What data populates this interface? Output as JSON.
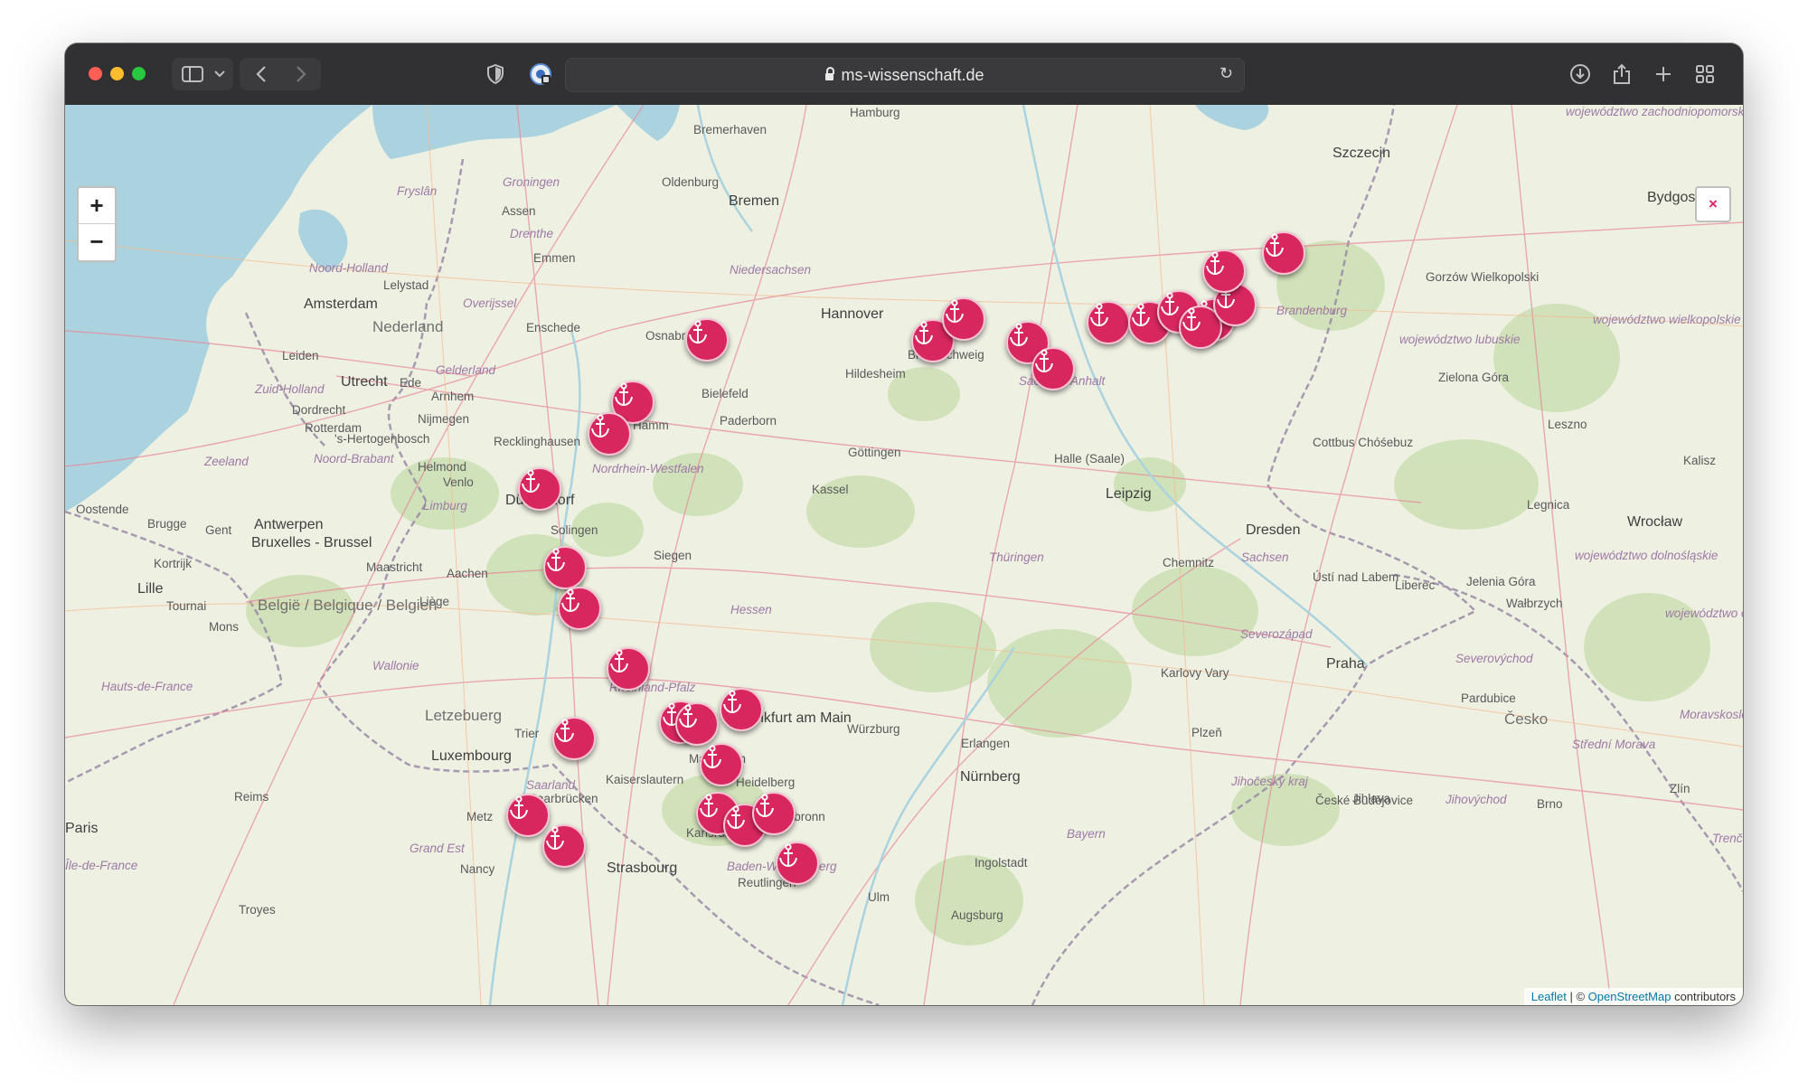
{
  "browser": {
    "url": "ms-wissenschaft.de"
  },
  "map": {
    "zoom_in_label": "+",
    "zoom_out_label": "−",
    "close_label": "×",
    "attribution": {
      "leaflet": "Leaflet",
      "separator": "| ©",
      "osm": "OpenStreetMap",
      "suffix": "contributors"
    },
    "marker_color": "#d8275f",
    "marker_icon": "anchor-icon",
    "marker_count": 36,
    "places": [
      "Hamburg",
      "Bremerhaven",
      "Szczecin",
      "Oldenburg",
      "Bremen",
      "Groningen",
      "Assen",
      "Fryslân",
      "Drenthe",
      "Emmen",
      "Niedersachsen",
      "Noord-Holland",
      "Lelystad",
      "Amsterdam",
      "Overijssel",
      "Nederland",
      "Enschede",
      "Osnabrück",
      "Hannover",
      "Braunschweig",
      "Hildesheim",
      "Gelderland",
      "Leiden",
      "Utrecht",
      "Ede",
      "Zuid-Holland",
      "Arnhem",
      "Bielefeld",
      "Sachsen-Anhalt",
      "Dordrecht",
      "Nijmegen",
      "Hamm",
      "Paderborn",
      "Rotterdam",
      "'s-Hertogenbosch",
      "Recklinghausen",
      "Göttingen",
      "Halle (Saale)",
      "Zeeland",
      "Noord-Brabant",
      "Helmond",
      "Nordrhein-Westfalen",
      "Venlo",
      "Düsseldorf",
      "Kassel",
      "Leipzig",
      "Oostende",
      "Brugge",
      "Gent",
      "Antwerpen",
      "Limburg",
      "Solingen",
      "Dresden",
      "Bruxelles - Brussel",
      "Maastricht",
      "Aachen",
      "Siegen",
      "Thüringen",
      "Chemnitz",
      "Sachsen",
      "Kortrijk",
      "Lille",
      "Tournai",
      "Liège",
      "België / Belgique / Belgien",
      "Hessen",
      "Mons",
      "Wallonie",
      "Rheinland-Pfalz",
      "Frankfurt am Main",
      "Karlovy Vary",
      "Praha",
      "Hauts-de-France",
      "Letzebuerg",
      "Trier",
      "Würzburg",
      "Erlangen",
      "Plzeň",
      "Luxembourg",
      "Saarland",
      "Kaiserslautern",
      "Mannheim",
      "Nürnberg",
      "Heidelberg",
      "Reims",
      "Saarbrücken",
      "Heilbronn",
      "Metz",
      "Karlsruhe",
      "Bayern",
      "Jihočeský kraj",
      "České Budějovice",
      "Grand Est",
      "Strasbourg",
      "Baden-Württemberg",
      "Ingolstadt",
      "Nancy",
      "Reutlingen",
      "Ulm",
      "Troyes",
      "Augsburg",
      "Paris",
      "Île-de-France",
      "Brandenburg",
      "Gorzów Wielkopolski",
      "województwo zachodniopomorskie",
      "województwo wielkopolskie",
      "województwo lubuskie",
      "Zielona Góra",
      "Cottbus Chóśebuz",
      "Leszno",
      "Legnica",
      "Wrocław",
      "Ústí nad Labem",
      "Liberec",
      "Jelenia Góra",
      "Wałbrzych",
      "Severozápad",
      "Severovýchod",
      "Pardubice",
      "Česko",
      "Střední Morava",
      "Jihovýchod",
      "Jihlava",
      "Brno",
      "Zlín",
      "Bydgoszcz",
      "Kalisz",
      "województwo dolnośląskie",
      "województwo opolskie",
      "Moravskoslezsko",
      "Trenčín"
    ]
  }
}
